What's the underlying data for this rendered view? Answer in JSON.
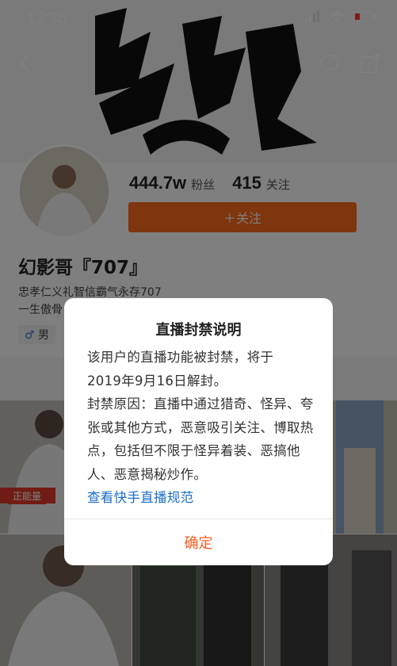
{
  "status_bar": {
    "time": "12:36"
  },
  "profile": {
    "fans_count": "444.7w",
    "fans_label": "粉丝",
    "following_count": "415",
    "following_label": "关注",
    "follow_button": "＋关注",
    "name": "幻影哥『707』",
    "bio_line1": "忠孝仁义礼智信霸气永存707",
    "bio_line2": "一生傲骨",
    "gender": "男"
  },
  "grid": {
    "tag_label": "正能量"
  },
  "dialog": {
    "title": "直播封禁说明",
    "body_line1": "该用户的直播功能被封禁，将于",
    "body_line2": "2019年9月16日解封。",
    "body_reason": "封禁原因：直播中通过猎奇、怪异、夸张或其他方式，恶意吸引关注、博取热点，包括但不限于怪异着装、恶搞他人、恶意揭秘炒作。",
    "link": "查看快手直播规范",
    "confirm": "确定"
  },
  "colors": {
    "accent": "#ff6a1a",
    "link": "#1b6fc9",
    "confirm": "#ff5a1f"
  }
}
